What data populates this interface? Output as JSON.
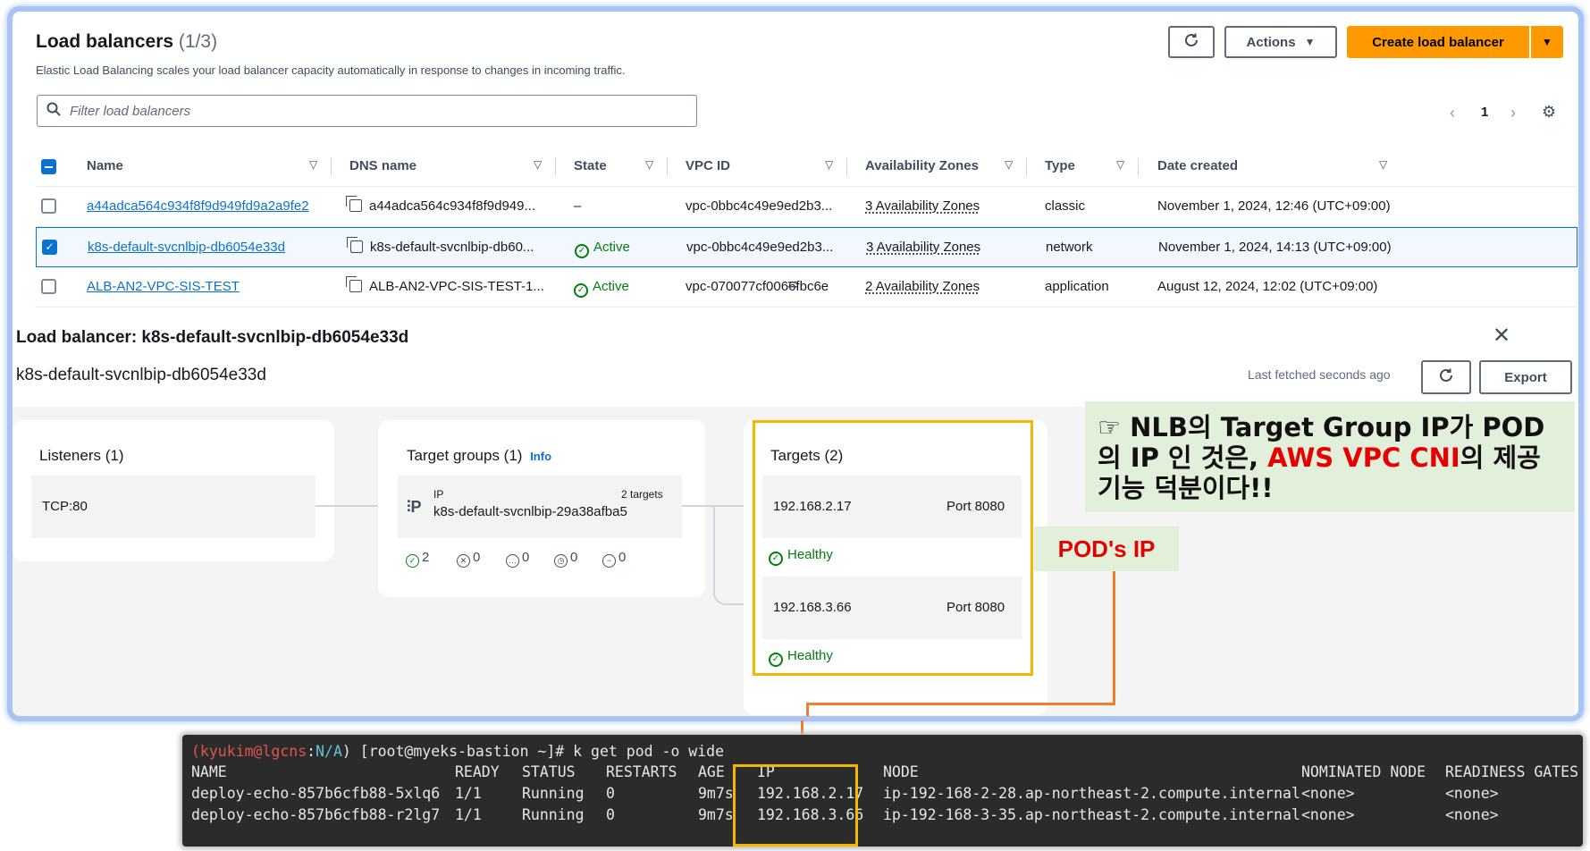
{
  "header": {
    "title": "Load balancers",
    "count": "(1/3)",
    "subtitle": "Elastic Load Balancing scales your load balancer capacity automatically in response to changes in incoming traffic.",
    "actions_label": "Actions",
    "create_label": "Create load balancer"
  },
  "search": {
    "placeholder": "Filter load balancers"
  },
  "pagination": {
    "page": "1"
  },
  "table": {
    "columns": [
      "Name",
      "DNS name",
      "State",
      "VPC ID",
      "Availability Zones",
      "Type",
      "Date created"
    ],
    "rows": [
      {
        "name": "a44adca564c934f8f9d949fd9a2a9fe2",
        "dns": "a44adca564c934f8f9d949...",
        "state": "–",
        "vpc": "vpc-0bbc4c49e9ed2b3...",
        "az": "3 Availability Zones",
        "type": "classic",
        "date": "November 1, 2024, 12:46 (UTC+09:00)",
        "selected": false
      },
      {
        "name": "k8s-default-svcnlbip-db6054e33d",
        "dns": "k8s-default-svcnlbip-db60...",
        "state": "Active",
        "vpc": "vpc-0bbc4c49e9ed2b3...",
        "az": "3 Availability Zones",
        "type": "network",
        "date": "November 1, 2024, 14:13 (UTC+09:00)",
        "selected": true
      },
      {
        "name": "ALB-AN2-VPC-SIS-TEST",
        "dns": "ALB-AN2-VPC-SIS-TEST-1...",
        "state": "Active",
        "vpc": "vpc-070077cf0066fbc6e",
        "az": "2 Availability Zones",
        "type": "application",
        "date": "August 12, 2024, 12:02 (UTC+09:00)",
        "selected": false
      }
    ]
  },
  "detail": {
    "title": "Load balancer: k8s-default-svcnlbip-db6054e33d",
    "subtitle": "k8s-default-svcnlbip-db6054e33d",
    "last_fetched": "Last fetched seconds ago",
    "export_label": "Export",
    "listeners": {
      "title": "Listeners (1)",
      "item": "TCP:80"
    },
    "target_groups": {
      "title": "Target groups (1)",
      "info": "Info",
      "type": "IP",
      "targets_count": "2 targets",
      "name": "k8s-default-svcnlbip-29a38afba5",
      "stats": [
        "2",
        "0",
        "0",
        "0",
        "0"
      ]
    },
    "targets": {
      "title": "Targets (2)",
      "items": [
        {
          "ip": "192.168.2.17",
          "port": "Port 8080",
          "health": "Healthy"
        },
        {
          "ip": "192.168.3.66",
          "port": "Port 8080",
          "health": "Healthy"
        }
      ]
    }
  },
  "annotations": {
    "callout_prefix": "☞ NLB의 Target Group IP가 POD 의 IP 인 것은, ",
    "callout_highlight": "AWS VPC CNI",
    "callout_suffix": "의 제공 기능 덕분이다!!",
    "pod_ip_label": "POD's IP"
  },
  "terminal": {
    "prompt_user": "(kyukim@lgcns",
    "prompt_sep": ":",
    "prompt_na": "N/A",
    "prompt_rest": ") [root@myeks-bastion ~]# k get pod -o wide",
    "headers": [
      "NAME",
      "READY",
      "STATUS",
      "RESTARTS",
      "AGE",
      "IP",
      "NODE",
      "NOMINATED NODE",
      "READINESS GATES"
    ],
    "rows": [
      [
        "deploy-echo-857b6cfb88-5xlq6",
        "1/1",
        "Running",
        "0",
        "9m7s",
        "192.168.2.17",
        "ip-192-168-2-28.ap-northeast-2.compute.internal",
        "<none>",
        "<none>"
      ],
      [
        "deploy-echo-857b6cfb88-r2lg7",
        "1/1",
        "Running",
        "0",
        "9m7s",
        "192.168.3.66",
        "ip-192-168-3-35.ap-northeast-2.compute.internal",
        "<none>",
        "<none>"
      ]
    ]
  },
  "colors": {
    "accent": "#ff9900",
    "link": "#0972d3",
    "healthy": "#037f0c",
    "highlight": "#f5b800",
    "annotation_red": "#e60000"
  }
}
